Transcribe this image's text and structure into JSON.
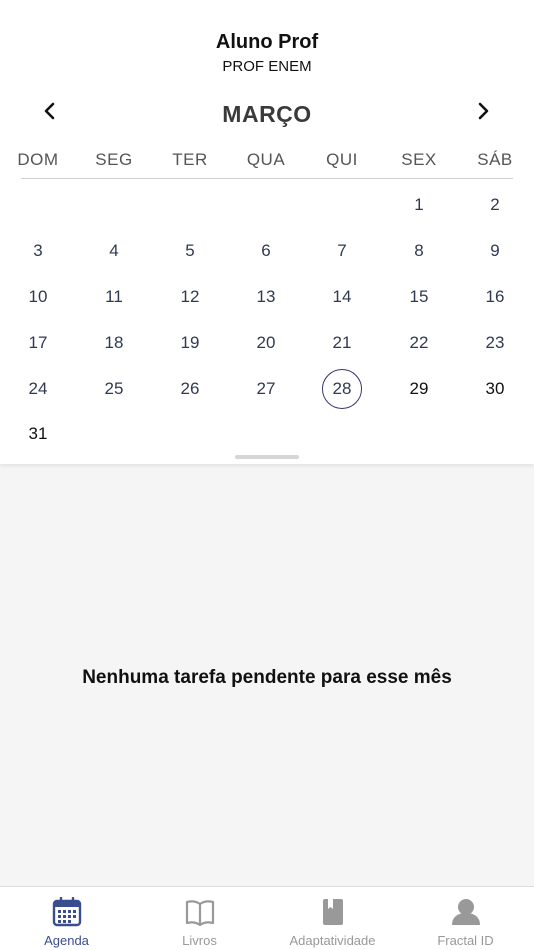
{
  "header": {
    "name": "Aluno Prof",
    "subtitle": "PROF ENEM"
  },
  "calendar": {
    "month": "MARÇO",
    "weekdays": [
      "DOM",
      "SEG",
      "TER",
      "QUA",
      "QUI",
      "SEX",
      "SÁB"
    ],
    "first_weekday_index": 5,
    "days_in_month": 31,
    "today": 28
  },
  "empty_state": {
    "message": "Nenhuma tarefa pendente para esse mês"
  },
  "tabs": [
    {
      "label": "Agenda",
      "icon": "calendar-icon",
      "active": true
    },
    {
      "label": "Livros",
      "icon": "book-icon",
      "active": false
    },
    {
      "label": "Adaptatividade",
      "icon": "bookmark-book-icon",
      "active": false
    },
    {
      "label": "Fractal ID",
      "icon": "user-icon",
      "active": false
    }
  ],
  "colors": {
    "active_tab": "#3a4d8f",
    "inactive_tab": "#999999",
    "today_ring": "#3b3573"
  }
}
